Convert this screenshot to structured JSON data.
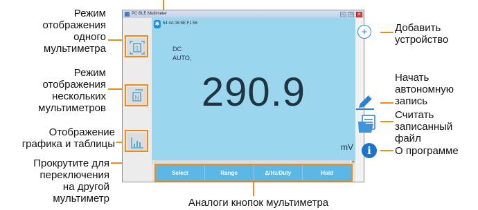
{
  "window": {
    "title": "PC BLE Multimeter",
    "buttons": [
      "–",
      "□",
      "x"
    ]
  },
  "device": {
    "address": "54:4A:16:5E:F1:56",
    "mode_line1": "DC",
    "mode_line2": "AUTO,",
    "reading": "290.9",
    "unit": "mV"
  },
  "softkeys": [
    {
      "label": "Select"
    },
    {
      "label": "Range"
    },
    {
      "label": "Δ/Hz/Duty"
    },
    {
      "label": "Hold"
    }
  ],
  "icons": {
    "mode_single": "1",
    "mode_multi": "N",
    "bluetooth": "✱",
    "add": "+",
    "info": "i"
  },
  "callouts": {
    "single_mode": "Режим\nотображения\nодного\nмультиметра",
    "multi_mode": "Режим\nотображения\nнескольких\nмультиметров",
    "chart_table": "Отображение\nграфика и таблицы",
    "scroll": "Прокрутите для\nпереключения\nна другой\nмультиметр",
    "softkeys": "Аналоги кнопок мультиметра",
    "add_device": "Добавить\nустройство",
    "start_logging": "Начать\nавтономную\nзапись",
    "read_file": "Считать\nзаписанный\nфайл",
    "about": "О программе"
  },
  "colors": {
    "accent": "#f08a12",
    "display_bg": "#9ad6ee",
    "softkey_bg": "#5ab7e6",
    "icon_blue": "#1d8fd6"
  }
}
